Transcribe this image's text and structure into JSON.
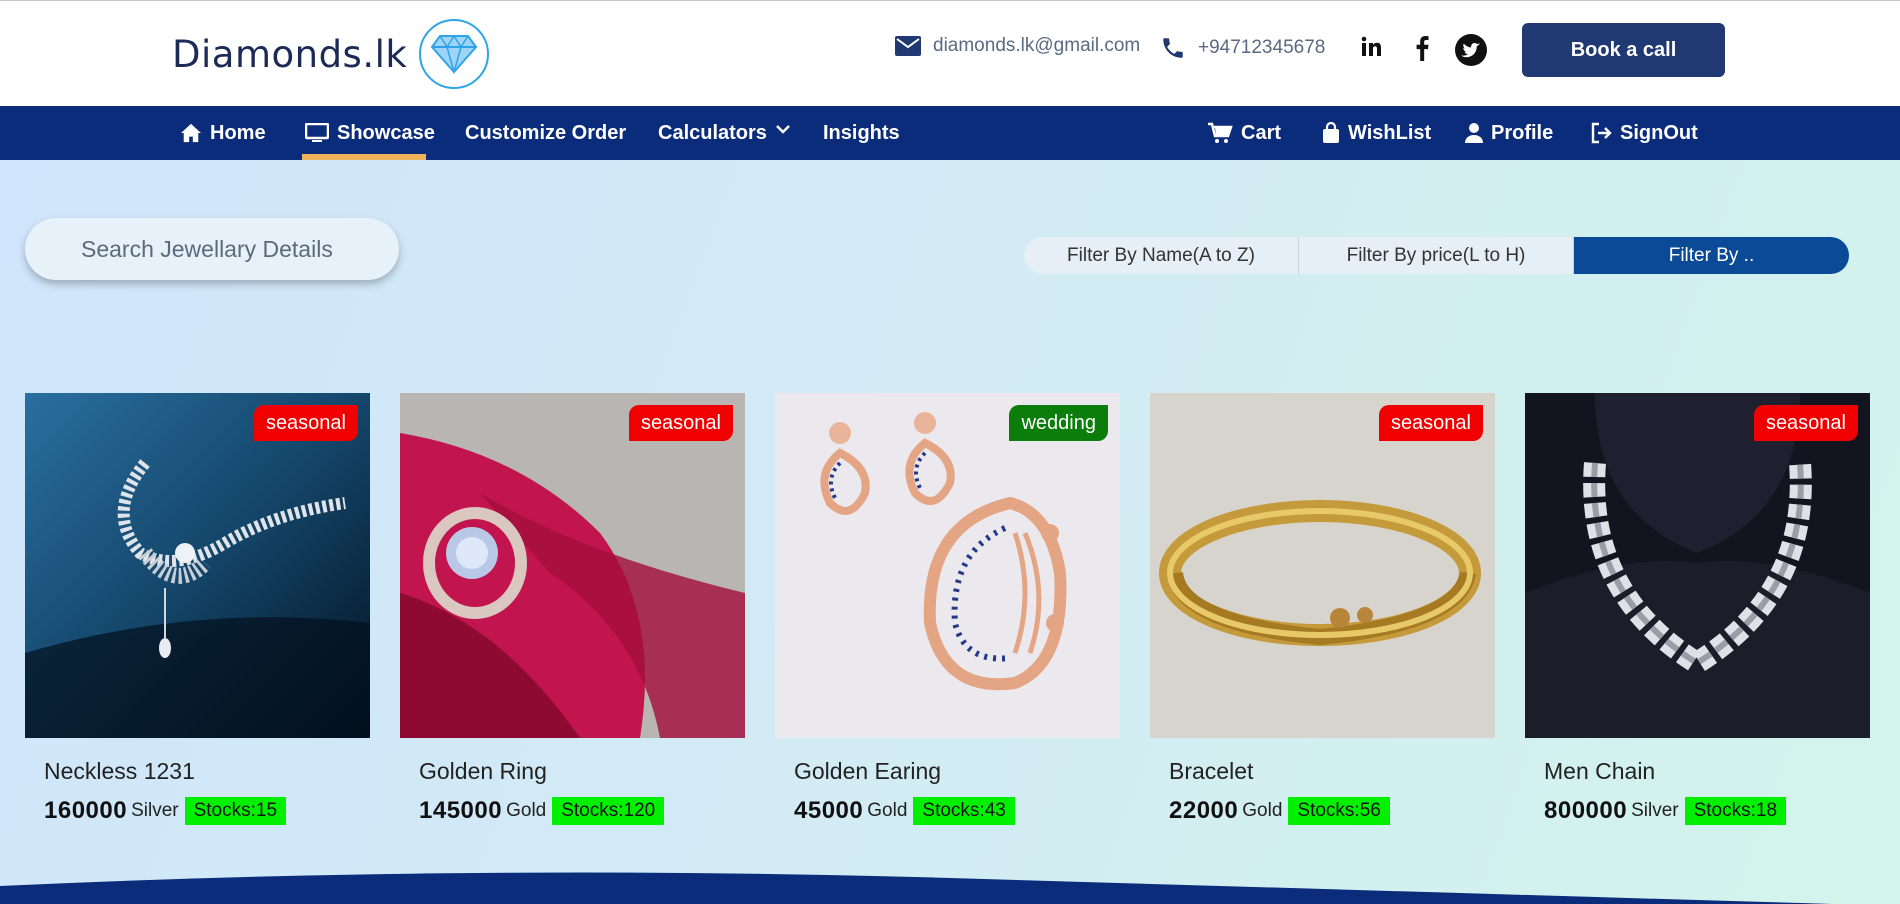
{
  "brand": {
    "name": "Diamonds.lk"
  },
  "contact": {
    "email": "diamonds.lk@gmail.com",
    "phone": "+94712345678"
  },
  "header": {
    "book_label": "Book a call"
  },
  "nav": {
    "left": [
      {
        "label": "Home",
        "icon": "home-icon"
      },
      {
        "label": "Showcase",
        "icon": "monitor-icon",
        "active": true
      },
      {
        "label": "Customize Order"
      },
      {
        "label": "Calculators",
        "icon": "chevron-down-icon"
      },
      {
        "label": "Insights"
      }
    ],
    "right": [
      {
        "label": "Cart",
        "icon": "cart-icon"
      },
      {
        "label": "WishList",
        "icon": "bag-icon"
      },
      {
        "label": "Profile",
        "icon": "user-icon"
      },
      {
        "label": "SignOut",
        "icon": "signout-icon"
      }
    ]
  },
  "search": {
    "placeholder": "Search Jewellary Details"
  },
  "filters": [
    "Filter By Name(A to Z)",
    "Filter By price(L to H)",
    "Filter By .."
  ],
  "products": [
    {
      "name": "Neckless 1231",
      "price": "160000",
      "metal": "Silver",
      "stock": "Stocks:15",
      "tag": "seasonal",
      "tag_color": "#f00000"
    },
    {
      "name": "Golden Ring",
      "price": "145000",
      "metal": "Gold",
      "stock": "Stocks:120",
      "tag": "seasonal",
      "tag_color": "#f00000"
    },
    {
      "name": "Golden Earing",
      "price": "45000",
      "metal": "Gold",
      "stock": "Stocks:43",
      "tag": "wedding",
      "tag_color": "#0a7d0a"
    },
    {
      "name": "Bracelet",
      "price": "22000",
      "metal": "Gold",
      "stock": "Stocks:56",
      "tag": "seasonal",
      "tag_color": "#f00000"
    },
    {
      "name": "Men Chain",
      "price": "800000",
      "metal": "Silver",
      "stock": "Stocks:18",
      "tag": "seasonal",
      "tag_color": "#f00000"
    }
  ],
  "colors": {
    "navbar": "#0a2c7a",
    "accent": "#f0b35c",
    "button": "#213973",
    "stock": "#00f000"
  }
}
